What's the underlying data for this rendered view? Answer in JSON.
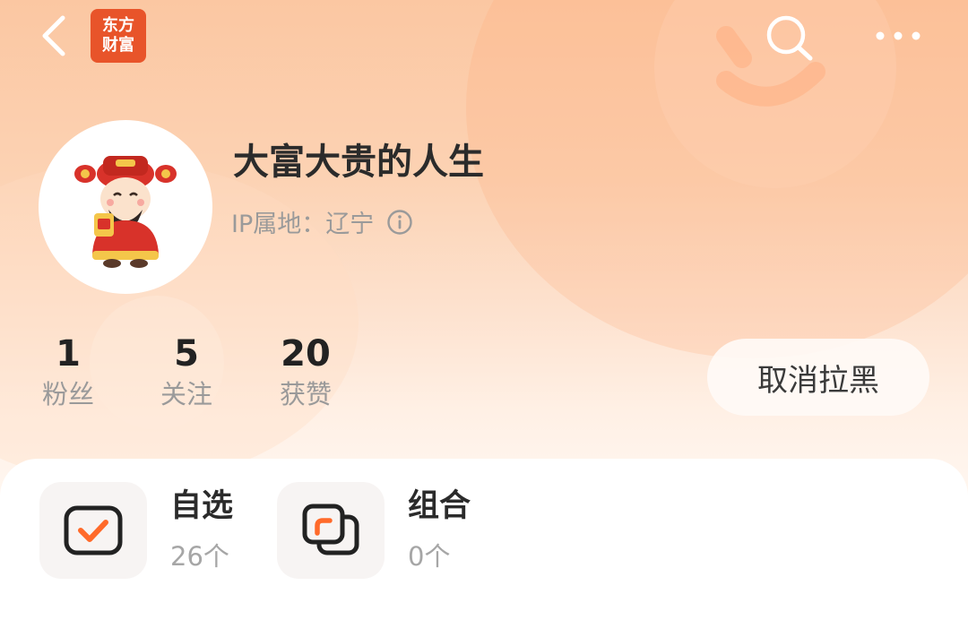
{
  "header": {
    "logo_line1": "东方",
    "logo_line2": "财富",
    "colors": {
      "brand": "#e8542a",
      "accent": "#ff6a2a"
    }
  },
  "profile": {
    "username": "大富大贵的人生",
    "ip_location": "IP属地：辽宁"
  },
  "stats": [
    {
      "value": "1",
      "label": "粉丝"
    },
    {
      "value": "5",
      "label": "关注"
    },
    {
      "value": "20",
      "label": "获赞"
    }
  ],
  "actions": {
    "unblock_label": "取消拉黑"
  },
  "features": [
    {
      "title": "自选",
      "count": "26个",
      "icon": "checkbox-icon"
    },
    {
      "title": "组合",
      "count": "0个",
      "icon": "portfolio-icon"
    }
  ],
  "icons": {
    "back": "back-icon",
    "search": "search-icon",
    "more": "more-icon",
    "info": "info-icon"
  }
}
